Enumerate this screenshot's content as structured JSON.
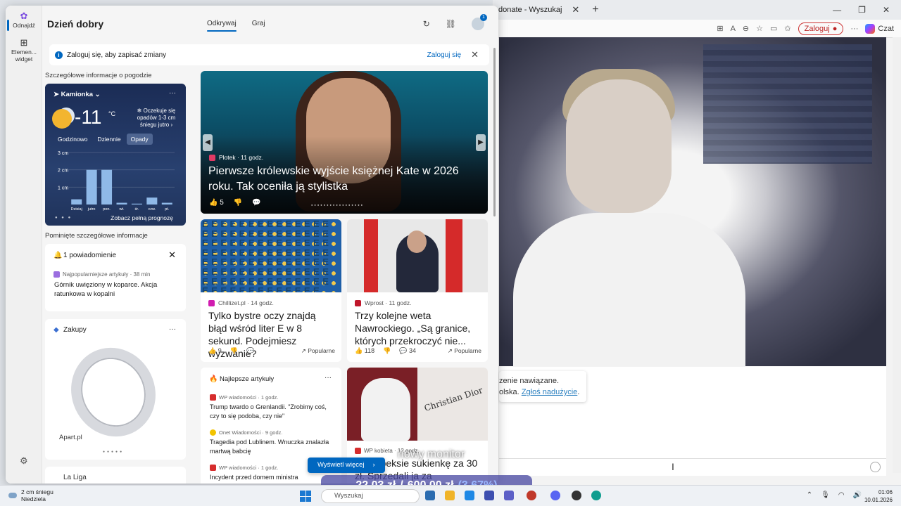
{
  "browser": {
    "tab_title": "donate - Wyszukaj",
    "login_label": "Zaloguj",
    "copilot_label": "Czat",
    "chat_line1": "zenie nawiązane.",
    "chat_line2_prefix": "olska.",
    "chat_report_link": "Zgłoś nadużycie"
  },
  "rail": {
    "discover_label": "Odnajdź",
    "widgets_label": "Elemen... widget"
  },
  "header": {
    "greeting": "Dzień dobry",
    "tab_discover": "Odkrywaj",
    "tab_play": "Graj",
    "avatar_badge": "1"
  },
  "signin": {
    "message": "Zaloguj się, aby zapisać zmiany",
    "link": "Zaloguj się"
  },
  "weather": {
    "section_label": "Szczegółowe informacje o pogodzie",
    "location": "Kamionka",
    "temperature": "-11",
    "unit": "°C",
    "forecast": "Oczekuje się opadów 1-3 cm śniegu jutro",
    "tabs": [
      "Godzinowo",
      "Dziennie",
      "Opady"
    ],
    "more": "Zobacz pełną prognozę",
    "chart_y_labels": [
      "3 cm",
      "2 cm",
      "1 cm"
    ],
    "chart_x_labels": [
      "Dzisiaj",
      "jutro",
      "pon.",
      "wt.",
      "śr.",
      "czw.",
      "pt."
    ]
  },
  "chart_data": {
    "type": "bar",
    "categories": [
      "Dzisiaj",
      "jutro",
      "pon.",
      "wt.",
      "śr.",
      "czw.",
      "pt."
    ],
    "values": [
      0.3,
      2.0,
      2.0,
      0.1,
      0.05,
      0.4,
      0.1
    ],
    "ylabel": "",
    "ylim": [
      0,
      3
    ],
    "ticks": [
      "1 cm",
      "2 cm",
      "3 cm"
    ]
  },
  "missed_label": "Pominięte szczegółowe informacje",
  "notification": {
    "title": "1 powiadomienie",
    "source": "Najpopularniejsze artykuły · 38 min",
    "headline": "Górnik uwięziony w koparce. Akcja ratunkowa w kopalni"
  },
  "shopping": {
    "title": "Zakupy",
    "brand": "Apart.pl"
  },
  "laliga": {
    "title": "La Liga"
  },
  "hero": {
    "source": "Plotek · 11 godz.",
    "title": "Pierwsze królewskie wyjście księżnej Kate w 2026 roku. Tak oceniła ją stylistka",
    "likes": "5"
  },
  "cards": [
    {
      "source": "Chillizet.pl · 14 godz.",
      "title": "Tylko bystre oczy znajdą błąd wśród liter E w 8 sekund. Podejmiesz wyzwanie?",
      "likes": "9",
      "comments": "",
      "badge": "Popularne",
      "img_text": "EEEEEEEEEEEEEEEEEEEEEEEEEEEEEEEEEEEEEEEEEEEEEEEEEEEEEEEEEEEEEEEEEEEEEEEEEEEEEEEEEEEEEEEEEEEEEEEEEEEEEEEEEEEEEEE"
    },
    {
      "source": "Wprost · 11 godz.",
      "title": "Trzy kolejne weta Nawrockiego. „Są granice, których przekroczyć nie...",
      "likes": "118",
      "comments": "34",
      "badge": "Popularne"
    }
  ],
  "best": {
    "title": "Najlepsze artykuły",
    "items": [
      {
        "source": "WP wiadomości · 1 godz.",
        "headline": "Trump twardo o Grenlandii. \"Zrobimy coś, czy to się podoba, czy nie\""
      },
      {
        "source": "Onet Wiadomości · 9 godz.",
        "headline": "Tragedia pod Lublinem. Wnuczka znalazła martwą babcię"
      },
      {
        "source": "WP wiadomości · 1 godz.",
        "headline": "Incydent przed domem ministra"
      }
    ]
  },
  "dior": {
    "brand": "Christian Dior",
    "source": "WP kobieta · 12 godz.",
    "title": "w lumpeksie sukienkę za 30 zł. Sprzedali ja za"
  },
  "see_more": "Wyświetl więcej",
  "overlay": {
    "monitor_text": "nowy monitor",
    "amount": "22,03 zł",
    "separator": "/",
    "goal": "600,00 zł",
    "percent": "(3,67%)"
  },
  "taskbar": {
    "weather_line1": "2 cm śniegu",
    "weather_line2": "Niedziela",
    "search_placeholder": "Wyszukaj",
    "time": "01:06",
    "date": "10.01.2026"
  },
  "colors": {
    "accent": "#0067c0",
    "weather_bg": "#1b2c55",
    "bar": "#8fb9e8"
  }
}
